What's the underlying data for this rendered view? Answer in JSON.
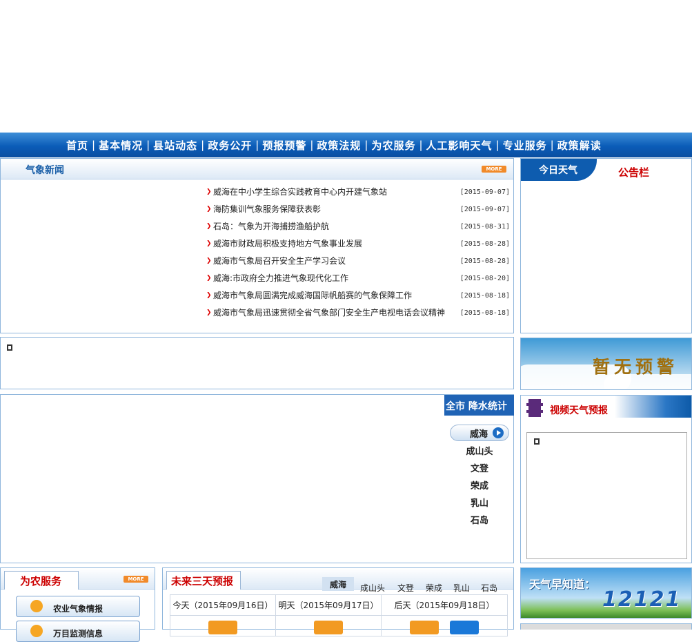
{
  "nav": [
    "首页",
    "基本情况",
    "县站动态",
    "政务公开",
    "预报预警",
    "政策法规",
    "为农服务",
    "人工影响天气",
    "专业服务",
    "政策解读"
  ],
  "news": {
    "title": "气象新闻",
    "more": "MORE",
    "items": [
      {
        "title": "威海在中小学生综合实践教育中心内开建气象站",
        "date": "[2015-09-07]"
      },
      {
        "title": "海防集训气象服务保障获表彰",
        "date": "[2015-09-07]"
      },
      {
        "title": "石岛：气象为开海捕捞渔船护航",
        "date": "[2015-08-31]"
      },
      {
        "title": "威海市财政局积极支持地方气象事业发展",
        "date": "[2015-08-28]"
      },
      {
        "title": "威海市气象局召开安全生产学习会议",
        "date": "[2015-08-28]"
      },
      {
        "title": "威海:市政府全力推进气象现代化工作",
        "date": "[2015-08-20]"
      },
      {
        "title": "威海市气象局圆满完成威海国际帆船赛的气象保障工作",
        "date": "[2015-08-18]"
      },
      {
        "title": "威海市气象局迅速贯彻全省气象部门安全生产电视电话会议精神",
        "date": "[2015-08-18]"
      }
    ]
  },
  "today": {
    "tab": "今日天气",
    "notice": "公告栏"
  },
  "warning": {
    "text": "暂无预警"
  },
  "rain": {
    "title": "全市 降水统计",
    "cities": [
      "威海",
      "成山头",
      "文登",
      "荣成",
      "乳山",
      "石岛"
    ]
  },
  "video": {
    "title": "视频天气预报"
  },
  "farm": {
    "title": "为农服务",
    "more": "MORE",
    "items": [
      "农业气象情报",
      "万目监测信息"
    ]
  },
  "forecast": {
    "title": "未来三天预报",
    "tabs": [
      "威海",
      "成山头",
      "文登",
      "荣成",
      "乳山",
      "石岛"
    ],
    "days": [
      "今天（2015年09月16日）",
      "明天（2015年09月17日）",
      "后天（2015年09月18日）"
    ]
  },
  "hotline": {
    "label": "天气早知道：",
    "number": "12121"
  }
}
